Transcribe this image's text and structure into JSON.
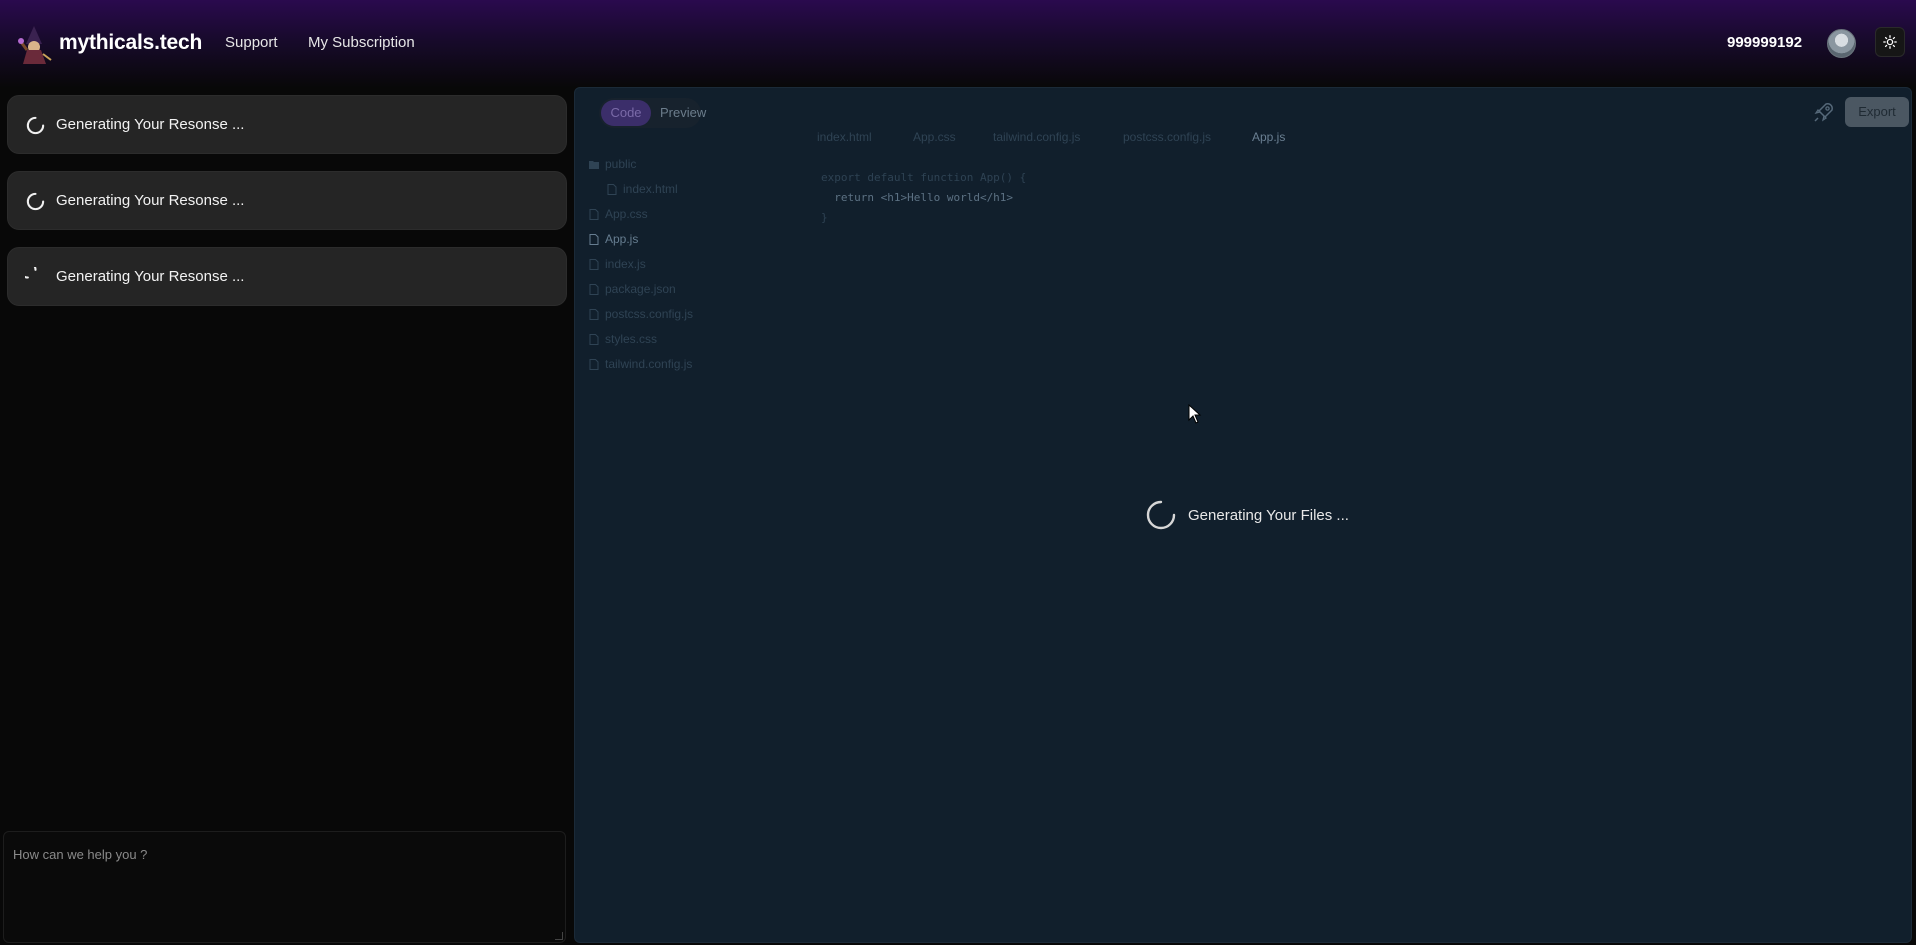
{
  "header": {
    "brand": "mythicals.tech",
    "nav": [
      {
        "label": "Support"
      },
      {
        "label": "My Subscription"
      }
    ],
    "credits": "999999192",
    "icons": {
      "logo": "wizard-logo-icon",
      "theme": "sun-icon",
      "avatar": "user-avatar"
    }
  },
  "chat": {
    "messages": [
      {
        "text": "Generating Your Resonse ..."
      },
      {
        "text": "Generating Your Resonse ..."
      },
      {
        "text": "Generating Your Resonse ..."
      }
    ],
    "input_placeholder": "How can we help you ?"
  },
  "workspace": {
    "tabs": {
      "code": "Code",
      "preview": "Preview"
    },
    "export_label": "Export",
    "file_tree": [
      {
        "label": "public",
        "type": "folder"
      },
      {
        "label": "index.html",
        "type": "file"
      },
      {
        "label": "App.css",
        "type": "file"
      },
      {
        "label": "App.js",
        "type": "file"
      },
      {
        "label": "index.js",
        "type": "file"
      },
      {
        "label": "package.json",
        "type": "file"
      },
      {
        "label": "postcss.config.js",
        "type": "file"
      },
      {
        "label": "styles.css",
        "type": "file"
      },
      {
        "label": "tailwind.config.js",
        "type": "file"
      }
    ],
    "open_tabs": [
      {
        "label": "index.html"
      },
      {
        "label": "App.css"
      },
      {
        "label": "tailwind.config.js"
      },
      {
        "label": "postcss.config.js"
      },
      {
        "label": "App.js"
      }
    ],
    "code_lines": [
      "export default function App() {",
      "  return <h1>Hello world</h1>",
      "}"
    ],
    "loading_text": "Generating Your Files ..."
  },
  "colors": {
    "accent": "#3b2e6a",
    "header_top": "#2a0a4e",
    "panel_bg": "#111f2c",
    "message_bg": "#252525"
  }
}
